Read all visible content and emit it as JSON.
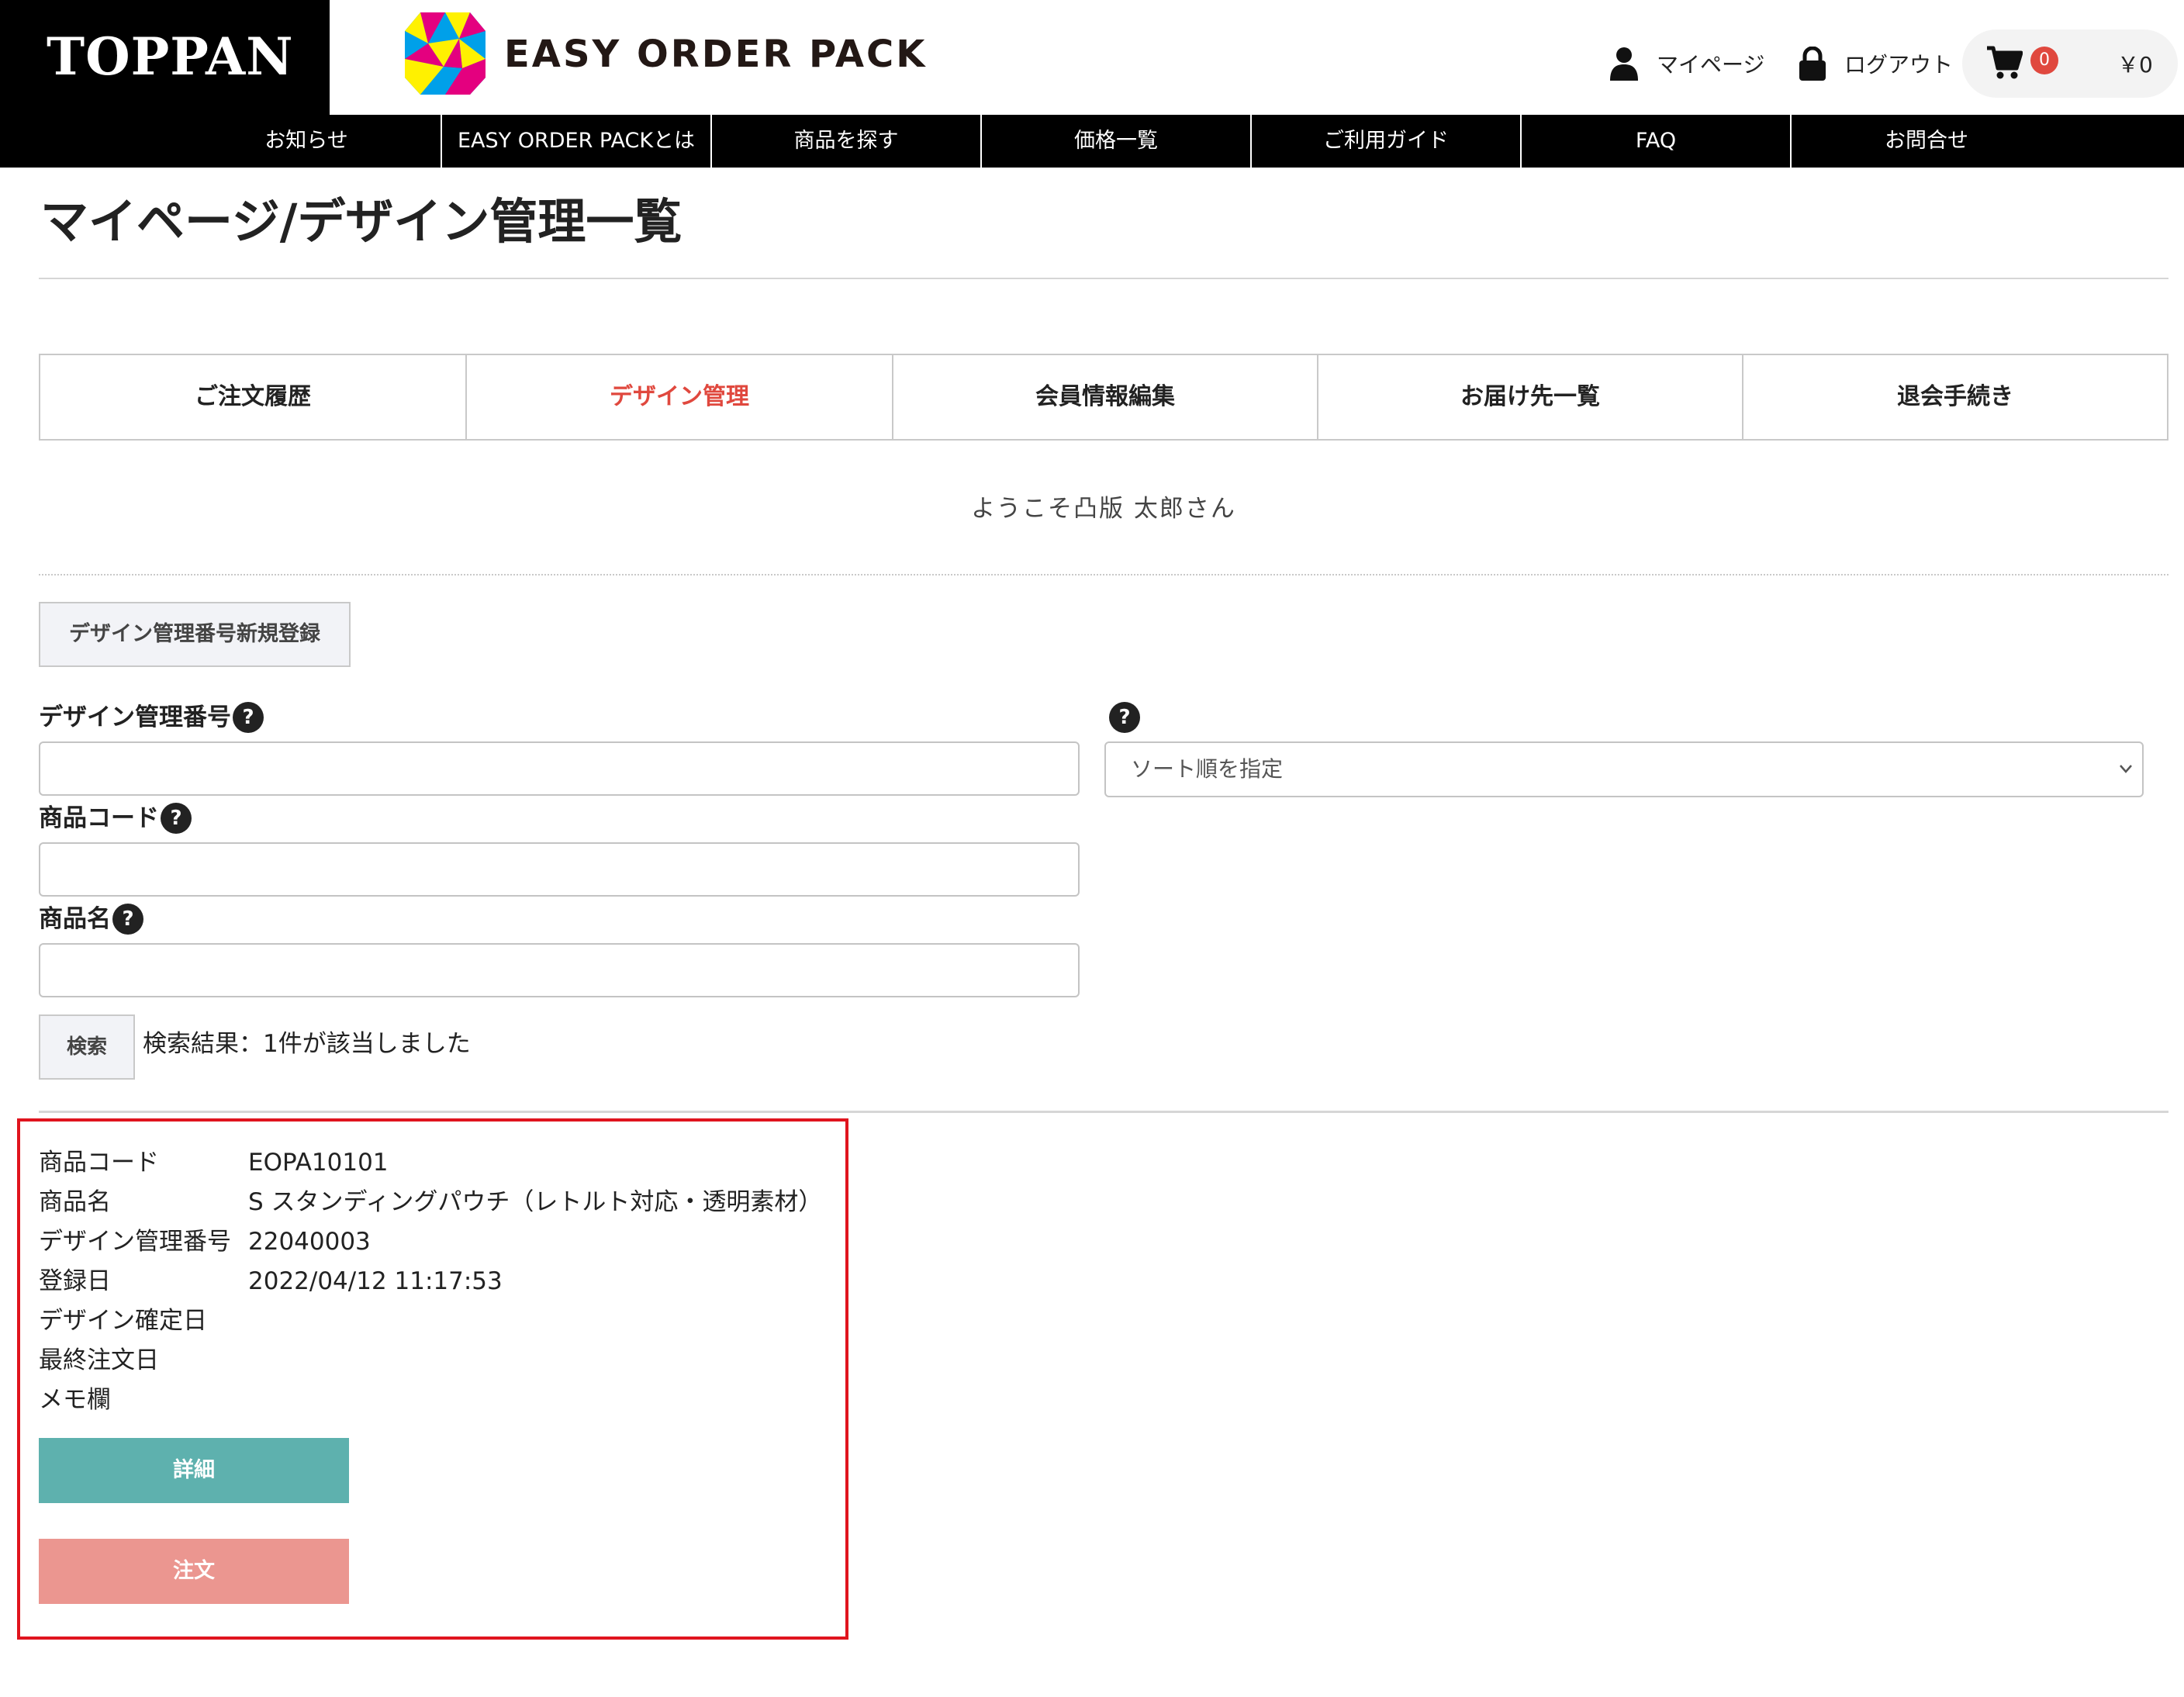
{
  "header": {
    "brand": "TOPPAN",
    "service_name": "EASY ORDER PACK",
    "mypage_label": "マイページ",
    "logout_label": "ログアウト",
    "cart_count": "0",
    "cart_total": "￥0"
  },
  "nav": {
    "items": [
      "お知らせ",
      "EASY ORDER PACKとは",
      "商品を探す",
      "価格一覧",
      "ご利用ガイド",
      "FAQ",
      "お問合せ"
    ]
  },
  "page": {
    "title": "マイページ/デザイン管理一覧"
  },
  "tabs": {
    "items": [
      "ご注文履歴",
      "デザイン管理",
      "会員情報編集",
      "お届け先一覧",
      "退会手続き"
    ],
    "active": "デザイン管理"
  },
  "welcome": "ようこそ凸版 太郎さん",
  "search": {
    "new_button": "デザイン管理番号新規登録",
    "design_number_label": "デザイン管理番号",
    "design_number_value": "",
    "product_code_label": "商品コード",
    "product_code_value": "",
    "product_name_label": "商品名",
    "product_name_value": "",
    "help_glyph": "?",
    "sort_placeholder": "ソート順を指定",
    "search_button": "検索",
    "result_text": "検索結果：1件が該当しました"
  },
  "result": {
    "fields": [
      {
        "label": "商品コード",
        "value": "EOPA10101"
      },
      {
        "label": "商品名",
        "value": "S スタンディングパウチ（レトルト対応・透明素材）"
      },
      {
        "label": "デザイン管理番号",
        "value": "22040003"
      },
      {
        "label": "登録日",
        "value": "2022/04/12 11:17:53"
      },
      {
        "label": "デザイン確定日",
        "value": ""
      },
      {
        "label": "最終注文日",
        "value": ""
      },
      {
        "label": "メモ欄",
        "value": ""
      }
    ],
    "detail_button": "詳細",
    "order_button": "注文",
    "highlight_color": "#e0141e"
  },
  "colors": {
    "header_bg": "#000000",
    "active_tab": "#e0483e",
    "detail_button": "#5eb1ae",
    "order_button": "#eb9690",
    "cart_badge": "#e0483e"
  },
  "icons": {
    "mypage": "user-icon",
    "logout": "lock-icon",
    "cart": "cart-icon",
    "sort": "chevron-down-icon",
    "help": "question-icon"
  }
}
